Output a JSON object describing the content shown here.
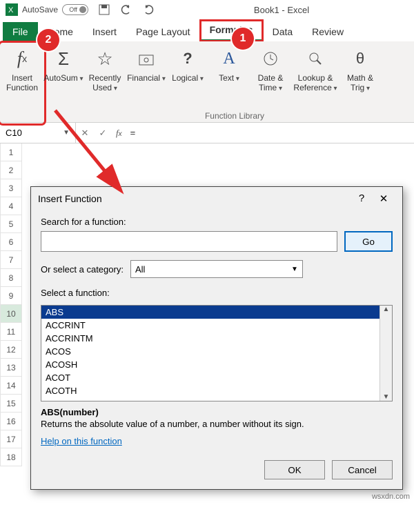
{
  "titlebar": {
    "autosave": "AutoSave",
    "autosave_state": "Off",
    "book": "Book1 - Excel"
  },
  "tabs": {
    "file": "File",
    "home": "Home",
    "insert": "Insert",
    "page_layout": "Page Layout",
    "formulas": "Formulas",
    "data": "Data",
    "review": "Review"
  },
  "ribbon": {
    "insert_function": "Insert\nFunction",
    "autosum": "AutoSum",
    "recently": "Recently\nUsed",
    "financial": "Financial",
    "logical": "Logical",
    "text": "Text",
    "datetime": "Date &\nTime",
    "lookup": "Lookup &\nReference",
    "math": "Math &\nTrig",
    "group_label": "Function Library"
  },
  "namebar": {
    "cell": "C10",
    "formula": "="
  },
  "callouts": {
    "one": "1",
    "two": "2"
  },
  "dialog": {
    "title": "Insert Function",
    "search_label": "Search for a function:",
    "search_value": "",
    "go": "Go",
    "category_label": "Or select a category:",
    "category_value": "All",
    "select_label": "Select a function:",
    "functions": [
      "ABS",
      "ACCRINT",
      "ACCRINTM",
      "ACOS",
      "ACOSH",
      "ACOT",
      "ACOTH"
    ],
    "signature": "ABS(number)",
    "description": "Returns the absolute value of a number, a number without its sign.",
    "help": "Help on this function",
    "ok": "OK",
    "cancel": "Cancel"
  },
  "watermark": "wsxdn.com"
}
